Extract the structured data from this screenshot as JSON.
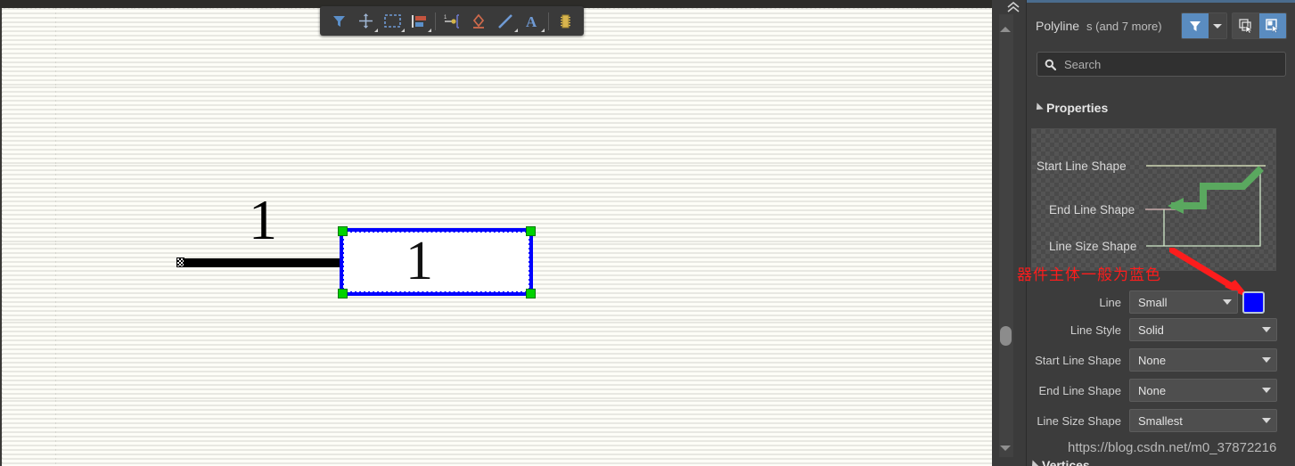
{
  "canvas": {
    "toolbar": {
      "items": [
        {
          "name": "filter-icon",
          "label": "Filter",
          "caret": false
        },
        {
          "name": "crosshair-icon",
          "label": "Place Crosshair",
          "caret": true
        },
        {
          "name": "selection-rectangle-icon",
          "label": "Rectangle Select",
          "caret": true
        },
        {
          "name": "align-icon",
          "label": "Align",
          "caret": true
        },
        {
          "name": "place-pin-icon",
          "label": "Place Pin",
          "caret": false
        },
        {
          "name": "ground-symbol-icon",
          "label": "Place Power Port",
          "caret": false
        },
        {
          "name": "line-icon",
          "label": "Place Line",
          "caret": true
        },
        {
          "name": "text-icon",
          "label": "Place Text",
          "caret": true
        },
        {
          "name": "ic-chip-icon",
          "label": "Place Part",
          "caret": false
        }
      ]
    },
    "wire_label": "1",
    "component_label": "1",
    "grid_color": "#96968c",
    "background_color": "#fdfdf7",
    "component_outline_color": "#0000ff",
    "handle_color": "#00d200"
  },
  "scrollbar": {
    "collapse_label": "Collapse",
    "up_label": "Scroll Up",
    "down_label": "Scroll Down"
  },
  "panel": {
    "title": "Polyline",
    "subtitle": "s (and 7 more)",
    "buttons": [
      {
        "name": "filter-button",
        "label": "Filter",
        "active": true
      },
      {
        "name": "filter-dropdown-button",
        "label": "Filter Options",
        "active": false
      },
      {
        "name": "select-multiple-button",
        "label": "Select Multiple",
        "active": false
      },
      {
        "name": "select-single-button",
        "label": "Select Single",
        "active": true
      }
    ],
    "search": {
      "placeholder": "Search",
      "value": ""
    },
    "sections": {
      "properties_label": "Properties",
      "vertices_label": "Vertices"
    },
    "preview": {
      "callouts": [
        {
          "name": "start-line-shape-callout",
          "label": "Start Line Shape"
        },
        {
          "name": "end-line-shape-callout",
          "label": "End Line Shape"
        },
        {
          "name": "line-size-shape-callout",
          "label": "Line Size Shape"
        }
      ],
      "polyline_color": "#5aa85f",
      "callout_color": "#cfe8c8"
    },
    "annotation": {
      "text": "器件主体一般为蓝色",
      "color": "#fc1d1d"
    },
    "properties": [
      {
        "name": "line",
        "label": "Line",
        "value": "Small",
        "has_color": true,
        "color": "#0000FF"
      },
      {
        "name": "line-style",
        "label": "Line Style",
        "value": "Solid",
        "has_color": false
      },
      {
        "name": "start-line-shape",
        "label": "Start Line Shape",
        "value": "None",
        "has_color": false
      },
      {
        "name": "end-line-shape",
        "label": "End Line Shape",
        "value": "None",
        "has_color": false
      },
      {
        "name": "line-size-shape",
        "label": "Line Size Shape",
        "value": "Smallest",
        "has_color": false
      }
    ],
    "watermark": "https://blog.csdn.net/m0_37872216"
  }
}
